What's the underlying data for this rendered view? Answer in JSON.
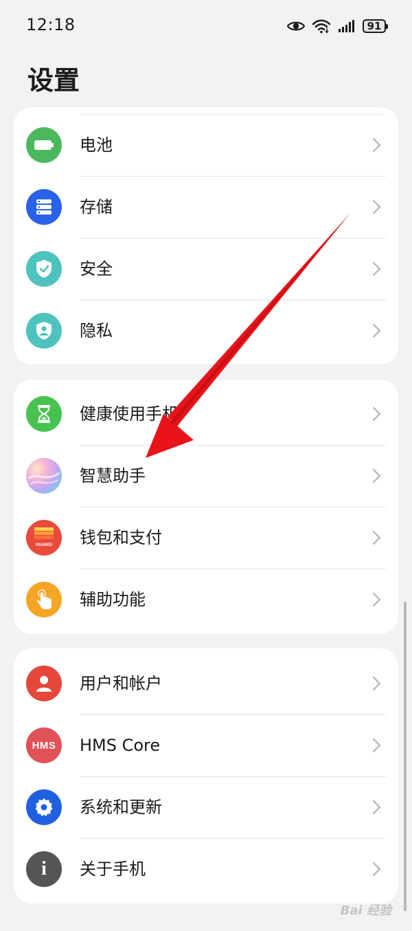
{
  "status_bar": {
    "time": "12:18",
    "battery": "91"
  },
  "header": {
    "title": "设置"
  },
  "groups": [
    {
      "items": [
        {
          "label": "电池",
          "icon": "battery-icon",
          "color": "#4cb85c"
        },
        {
          "label": "存储",
          "icon": "storage-icon",
          "color": "#2962e6"
        },
        {
          "label": "安全",
          "icon": "security-shield-icon",
          "color": "#4ec3bd"
        },
        {
          "label": "隐私",
          "icon": "privacy-shield-icon",
          "color": "#4ec3bd"
        }
      ]
    },
    {
      "items": [
        {
          "label": "健康使用手机",
          "icon": "hourglass-icon",
          "color": "#47c24e"
        },
        {
          "label": "智慧助手",
          "icon": "assistant-orb-icon",
          "color": "#c8a9ee"
        },
        {
          "label": "钱包和支付",
          "icon": "wallet-icon",
          "color": "#e84a3c"
        },
        {
          "label": "辅助功能",
          "icon": "hand-touch-icon",
          "color": "#f5a526"
        }
      ]
    },
    {
      "items": [
        {
          "label": "用户和帐户",
          "icon": "user-icon",
          "color": "#e5473a"
        },
        {
          "label": "HMS Core",
          "icon": "hms-icon",
          "color": "#e05257"
        },
        {
          "label": "系统和更新",
          "icon": "gear-icon",
          "color": "#2060e0"
        },
        {
          "label": "关于手机",
          "icon": "info-icon",
          "color": "#555555"
        }
      ]
    }
  ],
  "icon_text": {
    "hms": "HMS",
    "wallet_brand": "HUAWEI",
    "info": "i"
  },
  "watermark": "Bai 经验",
  "annotation_color": "#e8141a"
}
